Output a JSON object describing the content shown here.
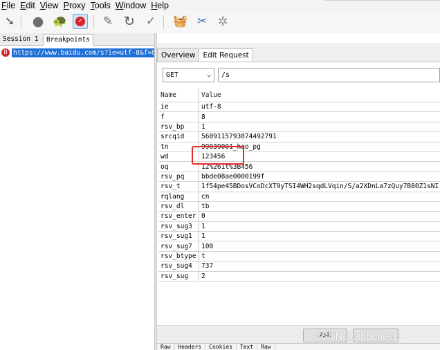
{
  "menu": [
    {
      "key": "F",
      "rest": "ile"
    },
    {
      "key": "E",
      "rest": "dit"
    },
    {
      "key": "V",
      "rest": "iew"
    },
    {
      "key": "P",
      "rest": "roxy"
    },
    {
      "key": "T",
      "rest": "ools"
    },
    {
      "key": "W",
      "rest": "indow"
    },
    {
      "key": "H",
      "rest": "elp"
    }
  ],
  "session_tabs": {
    "session": "Session 1",
    "breakpoints": "Breakpoints"
  },
  "request": {
    "url": "https://www.baidu.com/s?ie=utf-8&f=8"
  },
  "tabs": {
    "overview": "Overview",
    "edit_request": "Edit Request"
  },
  "edit": {
    "method": "GET",
    "path": "/s"
  },
  "params": {
    "name_header": "Name",
    "value_header": "Value",
    "rows": [
      {
        "name": "ie",
        "value": "utf-8"
      },
      {
        "name": "f",
        "value": "8"
      },
      {
        "name": "rsv_bp",
        "value": "1"
      },
      {
        "name": "srcqid",
        "value": "5609115793074492791"
      },
      {
        "name": "tn",
        "value": "99039001_hao_pg"
      },
      {
        "name": "wd",
        "value": "123456"
      },
      {
        "name": "oq",
        "value": "12%261t%3B456"
      },
      {
        "name": "rsv_pq",
        "value": "bbde08ae0000199f"
      },
      {
        "name": "rsv_t",
        "value": "1f54pe45BDosVCoDcXT9yTSI4WH2sqdLVqin/S/a2XDnLa7zQuy7B80Z1sNI"
      },
      {
        "name": "rqlang",
        "value": "cn"
      },
      {
        "name": "rsv_dl",
        "value": "tb"
      },
      {
        "name": "rsv_enter",
        "value": "0"
      },
      {
        "name": "rsv_sug3",
        "value": "1"
      },
      {
        "name": "rsv_sug1",
        "value": "1"
      },
      {
        "name": "rsv_sug7",
        "value": "100"
      },
      {
        "name": "rsv_btype",
        "value": "t"
      },
      {
        "name": "rsv_sug4",
        "value": "737"
      },
      {
        "name": "rsv_sug",
        "value": "2"
      }
    ]
  },
  "buttons": {
    "ask": "Ask"
  },
  "bottom_tabs": [
    "Raw",
    "Headers",
    "Cookies",
    "Text",
    "Raw"
  ],
  "watermark": "CSDN @shounian~",
  "colors": {
    "highlight": "#e52a2a",
    "selection": "#1f6fd6",
    "breakpoint": "#d9232d"
  }
}
